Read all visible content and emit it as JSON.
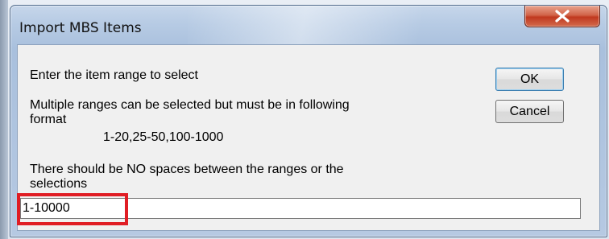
{
  "window": {
    "title": "Import MBS Items"
  },
  "titlebar": {
    "close_icon": "close-x-icon",
    "close_color": "#c7402a"
  },
  "dialog": {
    "prompt": "Enter the item range to select",
    "multi_line1": "Multiple ranges can be selected but must be in following",
    "multi_line2": "format",
    "example": "1-20,25-50,100-1000",
    "warning_line1": "There should be NO spaces between the ranges or the",
    "warning_line2": "selections",
    "range_value": "1-10000",
    "highlight_color": "#e01d24"
  },
  "buttons": {
    "ok": "OK",
    "cancel": "Cancel"
  }
}
